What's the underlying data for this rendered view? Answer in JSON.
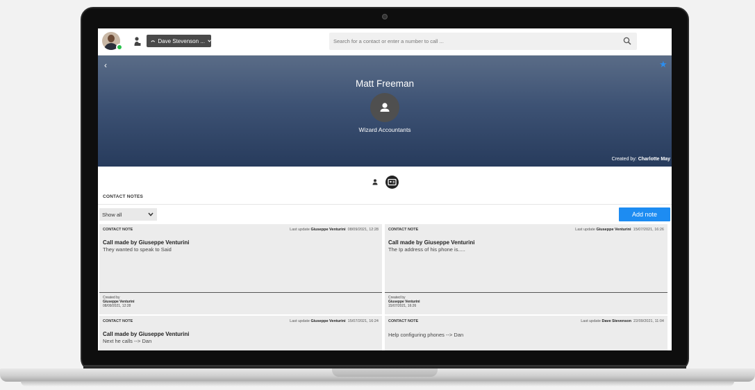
{
  "header": {
    "call_label": "Dave Stevenson ...",
    "search_placeholder": "Search for a contact or enter a number to call ..."
  },
  "contact": {
    "name": "Matt Freeman",
    "company": "Wizard Accountants",
    "created_by_label": "Created by:",
    "created_by_name": "Charlotte May"
  },
  "notes_section": {
    "title": "CONTACT NOTES",
    "filter_value": "Show all",
    "add_label": "Add note",
    "notes": [
      {
        "type": "CONTACT NOTE",
        "last_update_label": "Last update",
        "updated_by": "Giuseppe Venturini",
        "updated_at": "08/09/2021, 12:28",
        "title": "Call made by Giuseppe Venturini",
        "body": "They wanted to speak to Said",
        "created_by_label": "Created by",
        "created_by": "Giuseppe Venturini",
        "created_at": "08/09/2021, 12:28"
      },
      {
        "type": "CONTACT NOTE",
        "last_update_label": "Last update",
        "updated_by": "Giuseppe Venturini",
        "updated_at": "15/07/2021, 16:26",
        "title": "Call made by Giuseppe Venturini",
        "body": "The Ip address of his phone is.....",
        "created_by_label": "Created by",
        "created_by": "Giuseppe Venturini",
        "created_at": "15/07/2021, 16:26"
      },
      {
        "type": "CONTACT NOTE",
        "last_update_label": "Last update",
        "updated_by": "Giuseppe Venturini",
        "updated_at": "15/07/2021, 16:24",
        "title": "Call made by Giuseppe Venturini",
        "body": "Next he calls --> Dan"
      },
      {
        "type": "CONTACT NOTE",
        "last_update_label": "Last update",
        "updated_by": "Dave Stevenson",
        "updated_at": "22/09/2021, 11:04",
        "title": "",
        "body": "Help configuring phones --> Dan"
      }
    ]
  }
}
